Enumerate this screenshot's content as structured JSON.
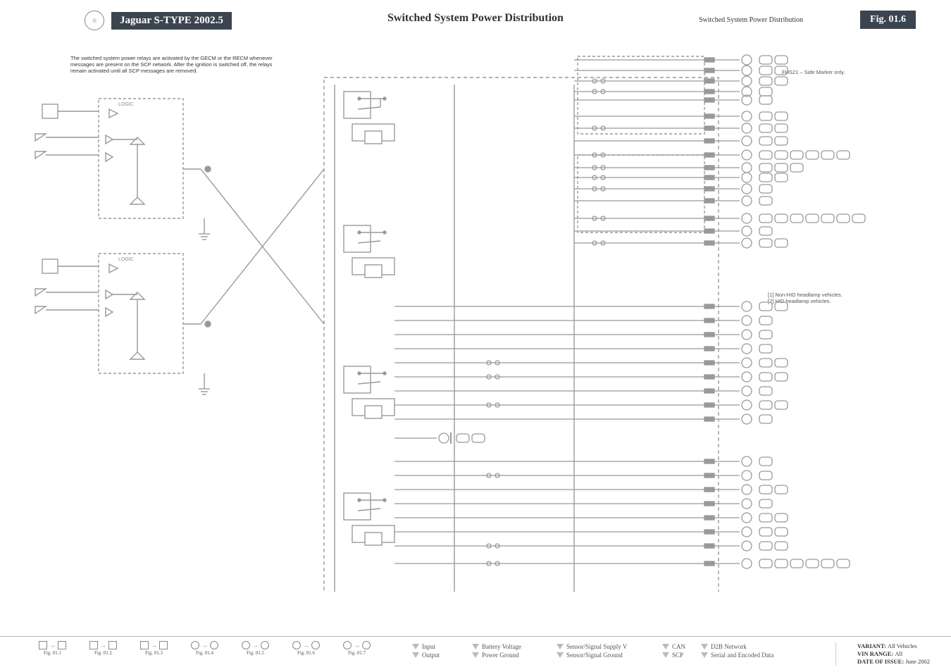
{
  "header": {
    "model": "Jaguar S-TYPE 2002.5",
    "title": "Switched System Power Distribution",
    "breadcrumb": "Switched System Power Distribution",
    "fig": "Fig. 01.6"
  },
  "intro": "The switched system power relays are activated by the GECM or the RECM whenever messages are present on the SCP network. After the ignition is switched off, the relays remain activated until all SCP messages are removed.",
  "notes": {
    "side_marker": "FHS21 – Side Marker only.",
    "headlamp": "[1] Non-HID headlamp vehicles.\n[2] HID headlamp vehicles."
  },
  "relay_logic": [
    "LOGIC",
    "LOGIC"
  ],
  "fig_nav": [
    {
      "label": "Fig. 01.1",
      "kind": "sq"
    },
    {
      "label": "Fig. 01.2",
      "kind": "sq"
    },
    {
      "label": "Fig. 01.3",
      "kind": "sq"
    },
    {
      "label": "Fig. 01.4",
      "kind": "ci"
    },
    {
      "label": "Fig. 01.5",
      "kind": "ci"
    },
    {
      "label": "Fig. 01.6",
      "kind": "ci"
    },
    {
      "label": "Fig. 01.7",
      "kind": "ci"
    }
  ],
  "legend": {
    "col1": [
      {
        "sym": "tri",
        "label": "Input"
      },
      {
        "sym": "tri",
        "label": "Output"
      }
    ],
    "col2": [
      {
        "sym": "tri",
        "label": "Battery Voltage"
      },
      {
        "sym": "tri",
        "label": "Power Ground"
      }
    ],
    "col3": [
      {
        "sym": "tri",
        "label": "Sensor/Signal Supply V"
      },
      {
        "sym": "tri",
        "label": "Sensor/Signal Ground"
      }
    ],
    "col4": [
      {
        "sym": "tri",
        "label": "CAN"
      },
      {
        "sym": "tri",
        "label": "SCP"
      }
    ],
    "col5": [
      {
        "sym": "tri",
        "label": "D2B Network"
      },
      {
        "sym": "tri",
        "label": "Serial and Encoded Data"
      }
    ]
  },
  "meta": {
    "variant_label": "VARIANT:",
    "variant_val": "All Vehicles",
    "vin_label": "VIN RANGE:",
    "vin_val": "All",
    "date_label": "DATE OF ISSUE:",
    "date_val": "June 2002"
  }
}
